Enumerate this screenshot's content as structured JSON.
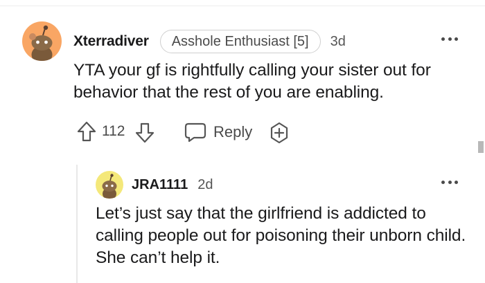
{
  "comment": {
    "username": "Xterradiver",
    "flair": "Asshole Enthusiast [5]",
    "age": "3d",
    "body": "YTA your gf is rightfully calling your sister out for behavior that the rest of you are enabling.",
    "avatar_color": "#f9a664",
    "actions": {
      "vote_count": "112",
      "reply_label": "Reply",
      "upvote_icon": "upvote-arrow-icon",
      "downvote_icon": "downvote-arrow-icon",
      "reply_icon": "chat-bubble-icon",
      "award_icon": "award-plus-icon"
    },
    "more_icon": "ellipsis-icon"
  },
  "reply": {
    "username": "JRA1111",
    "age": "2d",
    "body": "Let’s just say that the girlfriend is addicted to calling people out for poisoning their unborn child. She can’t help it.",
    "avatar_color": "#f4e87a",
    "more_icon": "ellipsis-icon"
  }
}
